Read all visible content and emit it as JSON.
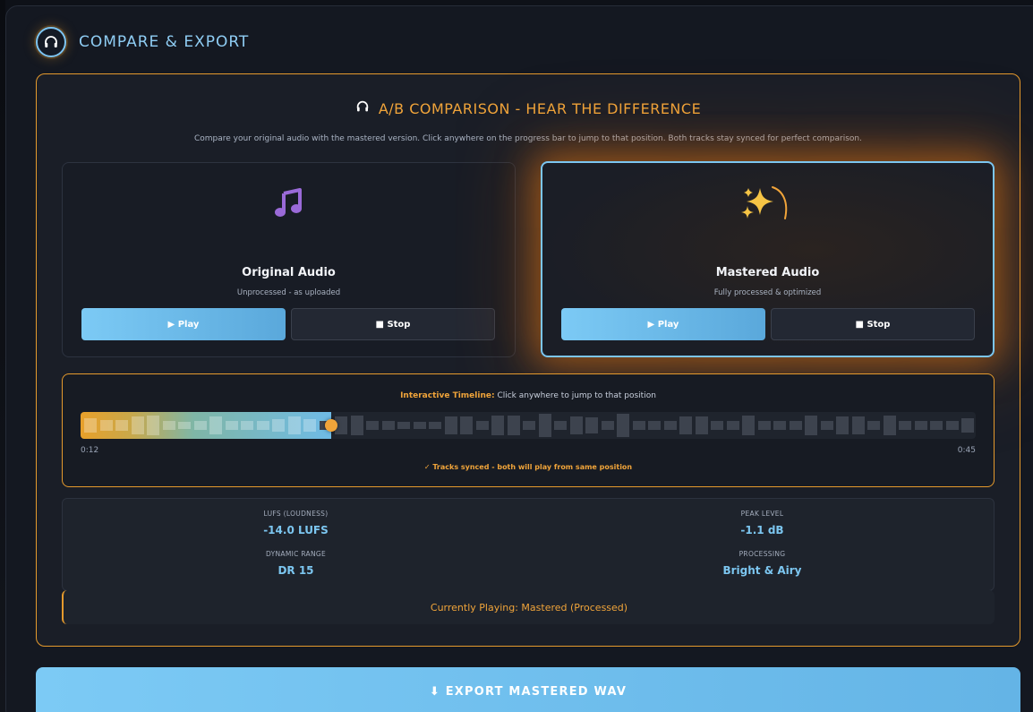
{
  "section": {
    "title": "COMPARE & EXPORT",
    "icon": "headphones-icon"
  },
  "ab": {
    "title": "A/B COMPARISON - HEAR THE DIFFERENCE",
    "description": "Compare your original audio with the mastered version. Click anywhere on the progress bar to jump to that position. Both tracks stay synced for perfect comparison.",
    "original": {
      "title": "Original Audio",
      "subtitle": "Unprocessed - as uploaded",
      "play": "▶ Play",
      "stop": "■ Stop",
      "icon": "music-note-icon"
    },
    "mastered": {
      "title": "Mastered Audio",
      "subtitle": "Fully processed & optimized",
      "play": "▶ Play",
      "stop": "■ Stop",
      "icon": "sparkles-icon"
    }
  },
  "timeline": {
    "hint_label": "Interactive Timeline:",
    "hint_text": " Click anywhere to jump to that position",
    "current_time": "0:12",
    "total_time": "0:45",
    "progress": 0.28,
    "sync_text": "✓ Tracks synced - both will play from same position"
  },
  "stats": {
    "lufs_label": "LUFS (LOUDNESS)",
    "lufs_value": "-14.0 LUFS",
    "peak_label": "PEAK LEVEL",
    "peak_value": "-1.1 dB",
    "dr_label": "DYNAMIC RANGE",
    "dr_value": "DR 15",
    "processing_label": "PROCESSING",
    "processing_value": "Bright & Airy"
  },
  "now_playing": "Currently Playing: Mastered (Processed)",
  "export": {
    "label": "⬇ EXPORT MASTERED WAV"
  },
  "colors": {
    "accent_orange": "#e59a2d",
    "accent_blue": "#7cc6f0",
    "background": "#1a1e27"
  }
}
